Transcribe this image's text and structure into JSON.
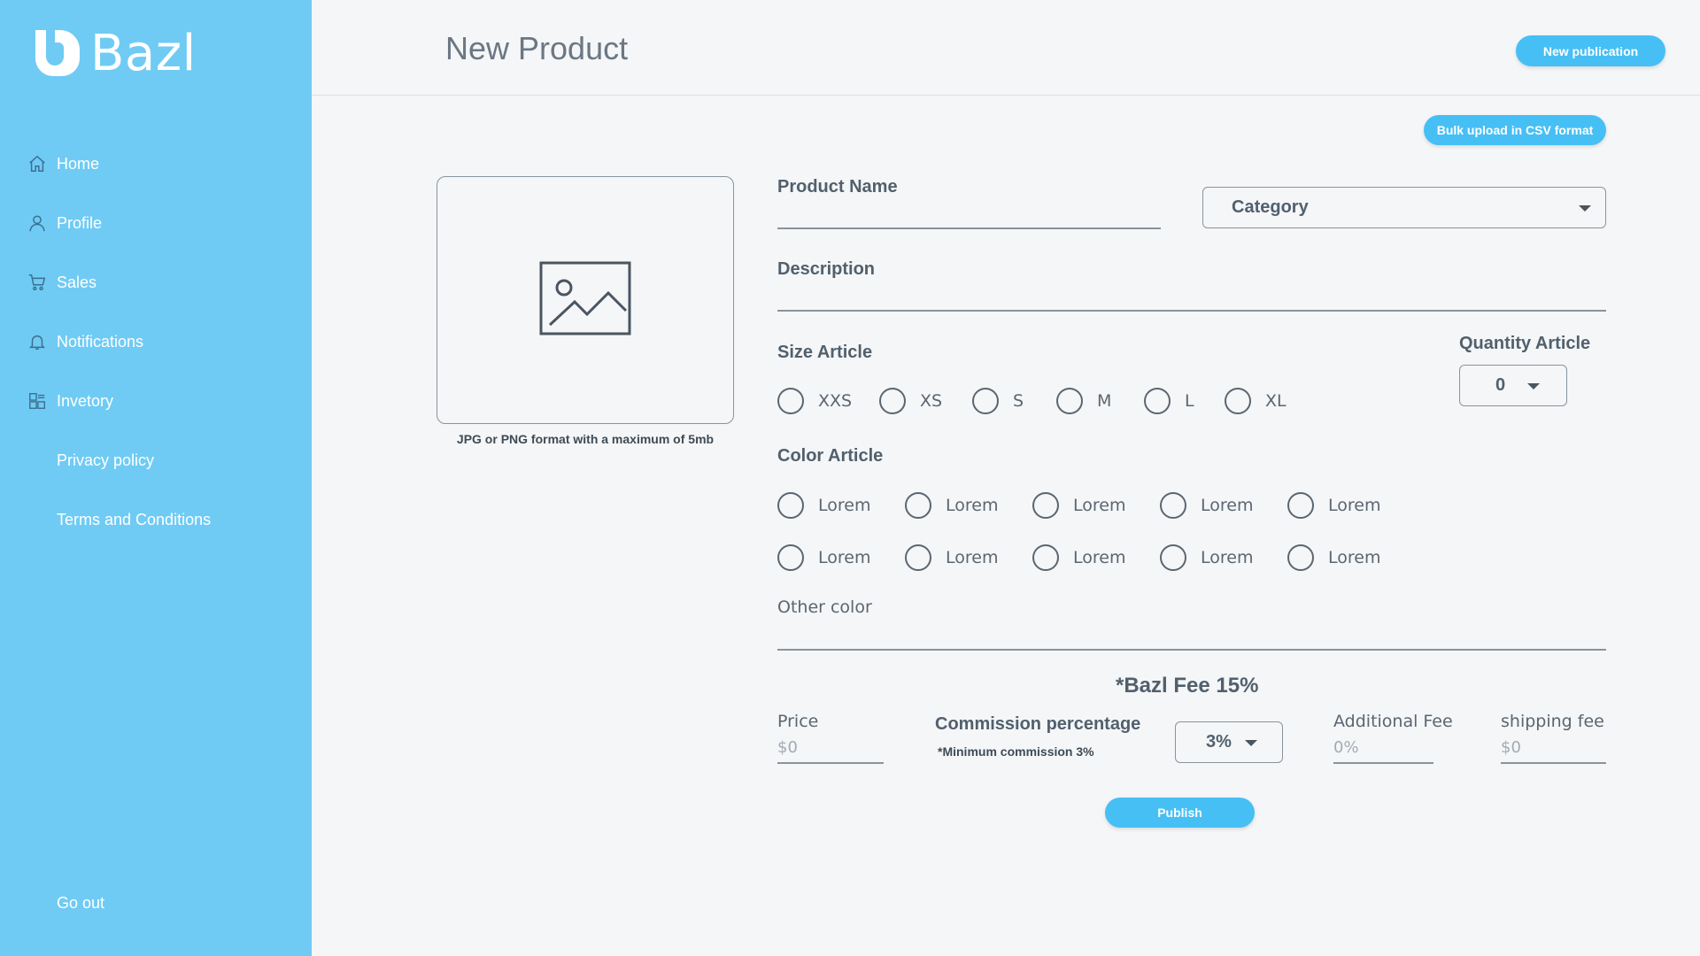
{
  "brand": {
    "name": "Bazl"
  },
  "sidebar": {
    "items": [
      {
        "label": "Home",
        "icon": "home-icon"
      },
      {
        "label": "Profile",
        "icon": "user-icon"
      },
      {
        "label": "Sales",
        "icon": "cart-icon"
      },
      {
        "label": "Notifications",
        "icon": "bell-icon"
      },
      {
        "label": "Invetory",
        "icon": "inventory-icon"
      },
      {
        "label": "Privacy policy",
        "icon": ""
      },
      {
        "label": "Terms and Conditions",
        "icon": ""
      }
    ],
    "logout_label": "Go out"
  },
  "header": {
    "title": "New Product",
    "new_publication_label": "New publication"
  },
  "form": {
    "bulk_upload_label": "Bulk upload in CSV format",
    "image_hint": "JPG or PNG format with a maximum of 5mb",
    "product_name_label": "Product Name",
    "category_placeholder": "Category",
    "description_label": "Description",
    "size_label": "Size Article",
    "sizes": [
      "XXS",
      "XS",
      "S",
      "M",
      "L",
      "XL"
    ],
    "quantity_label": "Quantity Article",
    "quantity_value": "0",
    "color_label": "Color Article",
    "colors_row1": [
      "Lorem",
      "Lorem",
      "Lorem",
      "Lorem",
      "Lorem"
    ],
    "colors_row2": [
      "Lorem",
      "Lorem",
      "Lorem",
      "Lorem",
      "Lorem"
    ],
    "other_color_label": "Other color",
    "fee_title": "*Bazl Fee 15%",
    "price_label": "Price",
    "price_placeholder": "$0",
    "commission_label": "Commission percentage",
    "commission_note": "*Minimum commission 3%",
    "commission_value": "3%",
    "additional_fee_label": "Additional Fee",
    "additional_fee_placeholder": "0%",
    "shipping_fee_label": "shipping fee",
    "shipping_fee_placeholder": "$0",
    "publish_label": "Publish"
  },
  "colors": {
    "sidebar": "#6fcbf4",
    "accent": "#46bff5",
    "background": "#f4f6f8"
  }
}
